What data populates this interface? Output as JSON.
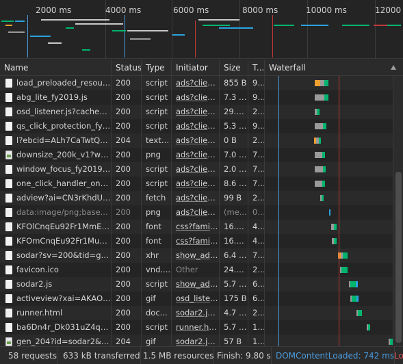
{
  "overview": {
    "ticks": [
      "2000 ms",
      "4000 ms",
      "6000 ms",
      "8000 ms",
      "10000 ms",
      "12000 ms"
    ]
  },
  "columns": {
    "name": "Name",
    "status": "Status",
    "type": "Type",
    "initiator": "Initiator",
    "size": "Size",
    "time": "T...",
    "waterfall": "Waterfall"
  },
  "rows": [
    {
      "name": "load_preloaded_resour...",
      "status": "200",
      "type": "script",
      "initiator": "ads?client...",
      "size": "855 B",
      "time": "9...",
      "icon": "file-icon"
    },
    {
      "name": "abg_lite_fy2019.js",
      "status": "200",
      "type": "script",
      "initiator": "ads?client...",
      "size": "7.3 kB",
      "time": "9...",
      "icon": "file-icon"
    },
    {
      "name": "osd_listener.js?cache=r...",
      "status": "200",
      "type": "script",
      "initiator": "ads?client...",
      "size": "29.1...",
      "time": "2...",
      "icon": "file-icon"
    },
    {
      "name": "qs_click_protection_fy2...",
      "status": "200",
      "type": "script",
      "initiator": "ads?client...",
      "size": "5.3 kB",
      "time": "9...",
      "icon": "file-icon"
    },
    {
      "name": "l?ebcid=ALh7CaTwtQQ...",
      "status": "204",
      "type": "text/...",
      "initiator": "ads?client...",
      "size": "0 B",
      "time": "2...",
      "icon": "file-icon"
    },
    {
      "name": "downsize_200k_v1?w=...",
      "status": "200",
      "type": "png",
      "initiator": "ads?client...",
      "size": "7.0 kB",
      "time": "7...",
      "icon": "image-icon"
    },
    {
      "name": "window_focus_fy2019.js",
      "status": "200",
      "type": "script",
      "initiator": "ads?client...",
      "size": "2.0 kB",
      "time": "7...",
      "icon": "file-icon"
    },
    {
      "name": "one_click_handler_one_...",
      "status": "200",
      "type": "script",
      "initiator": "ads?client...",
      "size": "8.6 kB",
      "time": "7...",
      "icon": "file-icon"
    },
    {
      "name": "adview?ai=CN3rKhdUC...",
      "status": "200",
      "type": "fetch",
      "initiator": "ads?client...",
      "size": "99 B",
      "time": "2...",
      "icon": "file-icon"
    },
    {
      "name": "data:image/png;base...",
      "status": "200",
      "type": "png",
      "initiator": "ads?client...",
      "size": "(me...",
      "time": "0...",
      "icon": "file-icon",
      "dim": true
    },
    {
      "name": "KFOlCnqEu92Fr1MmEU...",
      "status": "200",
      "type": "font",
      "initiator": "css?family...",
      "size": "16.0...",
      "time": "4...",
      "icon": "file-icon"
    },
    {
      "name": "KFOmCnqEu92Fr1Mu4...",
      "status": "200",
      "type": "font",
      "initiator": "css?family...",
      "size": "16.1...",
      "time": "4...",
      "icon": "file-icon"
    },
    {
      "name": "sodar?sv=200&tid=gd...",
      "status": "200",
      "type": "xhr",
      "initiator": "show_ads...",
      "size": "6.4 kB",
      "time": "7...",
      "icon": "file-icon"
    },
    {
      "name": "favicon.ico",
      "status": "200",
      "type": "vnd....",
      "initiator": "Other",
      "size": "24.2...",
      "time": "2...",
      "icon": "file-icon",
      "plainInitiator": true
    },
    {
      "name": "sodar2.js",
      "status": "200",
      "type": "script",
      "initiator": "show_ads...",
      "size": "5.7 kB",
      "time": "6...",
      "icon": "file-icon"
    },
    {
      "name": "activeview?xai=AKAOjs...",
      "status": "200",
      "type": "gif",
      "initiator": "osd_listen...",
      "size": "175 B",
      "time": "6...",
      "icon": "file-icon"
    },
    {
      "name": "runner.html",
      "status": "200",
      "type": "doc...",
      "initiator": "sodar2.js:...",
      "size": "4.7 kB",
      "time": "2...",
      "icon": "file-icon"
    },
    {
      "name": "ba6Dn4r_Dk031uZ4qac...",
      "status": "200",
      "type": "script",
      "initiator": "runner.ht...",
      "size": "5.7 kB",
      "time": "1...",
      "icon": "file-icon"
    },
    {
      "name": "gen_204?id=sodar2&v...",
      "status": "204",
      "type": "gif",
      "initiator": "sodar2.js:...",
      "size": "57 B",
      "time": "1...",
      "icon": "image-icon"
    }
  ],
  "status": {
    "requests": "58 requests",
    "transferred": "633 kB transferred",
    "resources": "1.5 MB resources",
    "finish": "Finish: 9.80 s",
    "dcl": "DOMContentLoaded: 742 ms",
    "load": "Lo"
  },
  "colors": {
    "background": "#242424",
    "dcl_line": "#4a9de0",
    "load_line": "#c33a3a",
    "waiting": "#00b46e",
    "download": "#2ba3e0",
    "queued": "#9a9a9a",
    "dns": "#f0a030"
  }
}
